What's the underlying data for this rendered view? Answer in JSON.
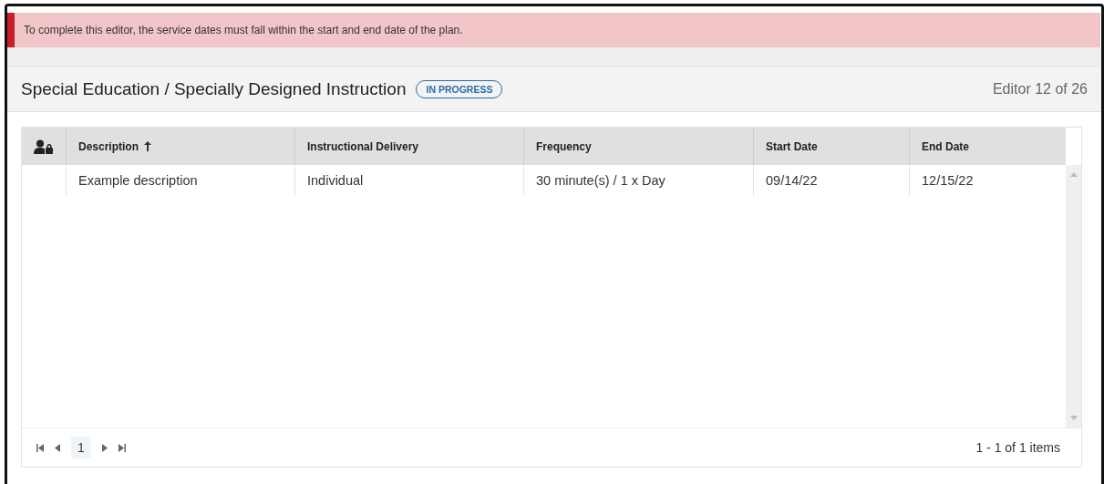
{
  "alert": {
    "message": "To complete this editor, the service dates must fall within the start and end date of the plan."
  },
  "header": {
    "title": "Special Education / Specially Designed Instruction",
    "status": "IN PROGRESS",
    "counter": "Editor 12 of 26"
  },
  "table": {
    "columns": [
      {
        "label": "Description",
        "sorted": true
      },
      {
        "label": "Instructional Delivery",
        "sorted": false
      },
      {
        "label": "Frequency",
        "sorted": false
      },
      {
        "label": "Start Date",
        "sorted": false
      },
      {
        "label": "End Date",
        "sorted": false
      }
    ],
    "rows": [
      {
        "cells": [
          "Example description",
          "Individual",
          "30 minute(s) / 1 x Day",
          "09/14/22",
          "12/15/22"
        ]
      }
    ]
  },
  "pager": {
    "pages": [
      {
        "label": "1",
        "selected": true
      }
    ],
    "summary": "1 - 1 of 1 items"
  }
}
